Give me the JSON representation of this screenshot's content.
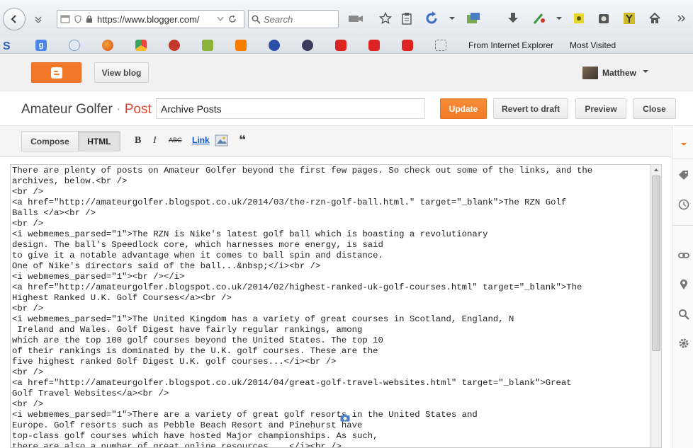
{
  "browser": {
    "url": "https://www.blogger.com/",
    "search_placeholder": "Search"
  },
  "bookmarks": {
    "from_ie": "From Internet Explorer",
    "most_visited": "Most Visited"
  },
  "header": {
    "view_blog": "View blog",
    "user_name": "Matthew"
  },
  "post": {
    "blog_name": "Amateur Golfer",
    "separator": "·",
    "post_word": "Post",
    "title_value": "Archive Posts",
    "update": "Update",
    "revert": "Revert to draft",
    "preview": "Preview",
    "close": "Close"
  },
  "toolbar": {
    "compose": "Compose",
    "html": "HTML",
    "bold": "B",
    "italic": "I",
    "strike": "ABC",
    "link": "Link",
    "quote": "❝"
  },
  "editor": {
    "lines": [
      "There are plenty of posts on Amateur Golfer beyond the first few pages. So check out some of the links, and the",
      "archives, below.<br />",
      "<br />",
      "<a href=\"http://amateurgolfer.blogspot.co.uk/2014/03/the-rzn-golf-ball.html.\" target=\"_blank\">The RZN Golf",
      "Balls </a><br />",
      "<br />",
      "<i webmemes_parsed=\"1\">The RZN is Nike's latest golf ball which is boasting a revolutionary",
      "design. The ball's Speedlock core, which harnesses more energy, is said",
      "to give it a notable advantage when it comes to ball spin and distance.",
      "One of Nike's directors said of the ball...&nbsp;</i><br />",
      "<i webmemes_parsed=\"1\"><br /></i>",
      "<a href=\"http://amateurgolfer.blogspot.co.uk/2014/02/highest-ranked-uk-golf-courses.html\" target=\"_blank\">The",
      "Highest Ranked U.K. Golf Courses</a><br />",
      "<br />",
      "<i webmemes_parsed=\"1\">The United Kingdom has a variety of great courses in Scotland, England, N",
      " Ireland and Wales. Golf Digest have fairly regular rankings, among",
      "which are the top 100 golf courses beyond the United States. The top 10",
      "of their rankings is dominated by the U.K. golf courses. These are the",
      "five highest ranked Golf Digest U.K. golf courses...</i><br />",
      "<br />",
      "<a href=\"http://amateurgolfer.blogspot.co.uk/2014/04/great-golf-travel-websites.html\" target=\"_blank\">Great",
      "Golf Travel Websites</a><br />",
      "<br />",
      "<i webmemes_parsed=\"1\">There are a variety of great golf resorts in the United States and",
      "Europe. Golf resorts such as Pebble Beach Resort and Pinehurst have",
      "top-class golf courses which have hosted Major championships. As such,",
      "there are also a number of great online resources... </i><br />"
    ]
  },
  "colors": {
    "accent_orange": "#f27b26",
    "post_red": "#dd4b39"
  }
}
